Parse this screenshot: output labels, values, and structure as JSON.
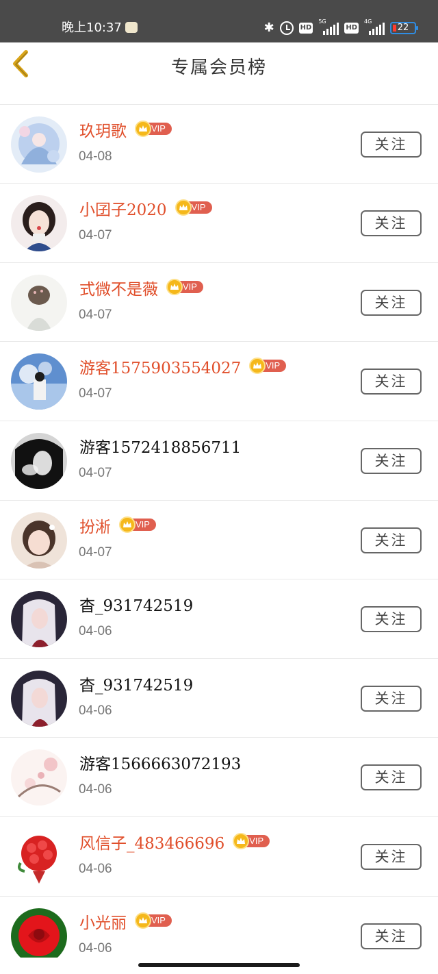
{
  "status_bar": {
    "time": "晚上10:37",
    "net1": "5G",
    "net2": "4G",
    "hd": "HD",
    "battery": "22"
  },
  "header": {
    "title": "专属会员榜",
    "back_icon": "chevron-left-icon",
    "accent_color": "#e8b020"
  },
  "follow_label": "关注",
  "vip_label": "VIP",
  "colors": {
    "vip_name": "#e04e2a",
    "plain_name": "#111111",
    "date": "#777777",
    "vip_pill": "#e05f4f",
    "crown": "#f5b81b"
  },
  "partial_top_row": {
    "date": "04-08"
  },
  "members": [
    {
      "name": "玖玥歌",
      "date": "04-08",
      "vip": true
    },
    {
      "name": "小囝子2020",
      "date": "04-07",
      "vip": true
    },
    {
      "name": "式微不是薇",
      "date": "04-07",
      "vip": true
    },
    {
      "name": "游客1575903554027",
      "date": "04-07",
      "vip": true
    },
    {
      "name": "游客1572418856711",
      "date": "04-07",
      "vip": false
    },
    {
      "name": "扮淅",
      "date": "04-07",
      "vip": true
    },
    {
      "name": "杳_931742519",
      "date": "04-06",
      "vip": false
    },
    {
      "name": "杳_931742519",
      "date": "04-06",
      "vip": false
    },
    {
      "name": "游客1566663072193",
      "date": "04-06",
      "vip": false
    },
    {
      "name": "风信子_483466696",
      "date": "04-06",
      "vip": true
    },
    {
      "name": "小光丽",
      "date": "04-06",
      "vip": true
    }
  ]
}
